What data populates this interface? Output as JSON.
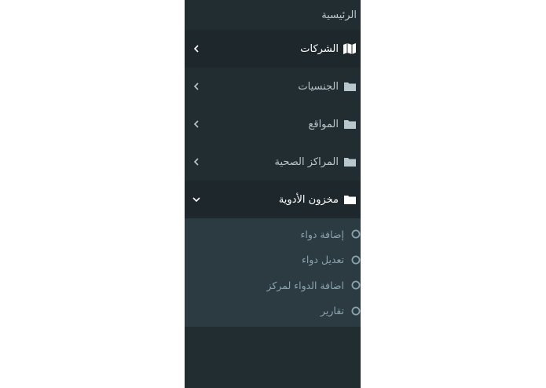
{
  "sidebar": {
    "header": "الرئيسية",
    "items": [
      {
        "label": "الشركات",
        "icon": "map-icon",
        "state": "collapsed"
      },
      {
        "label": "الجنسيات",
        "icon": "folder-icon",
        "state": "collapsed"
      },
      {
        "label": "المواقع",
        "icon": "folder-icon",
        "state": "collapsed"
      },
      {
        "label": "المراكز الصحية",
        "icon": "folder-icon",
        "state": "collapsed"
      },
      {
        "label": "مخزون الأدوية",
        "icon": "folder-icon",
        "state": "expanded"
      }
    ],
    "submenu": [
      {
        "label": "إضافة دواء",
        "icon": "circle-icon"
      },
      {
        "label": "تعديل دواء",
        "icon": "circle-icon"
      },
      {
        "label": "اضافة الدواء لمركز",
        "icon": "circle-icon"
      },
      {
        "label": "تقارير",
        "icon": "circle-icon"
      }
    ]
  },
  "colors": {
    "sidebar_bg": "#222d32",
    "active_bg": "#1e282c",
    "submenu_bg": "#2c3b41",
    "text": "#b8c7ce",
    "subtext": "#8aa4af"
  }
}
